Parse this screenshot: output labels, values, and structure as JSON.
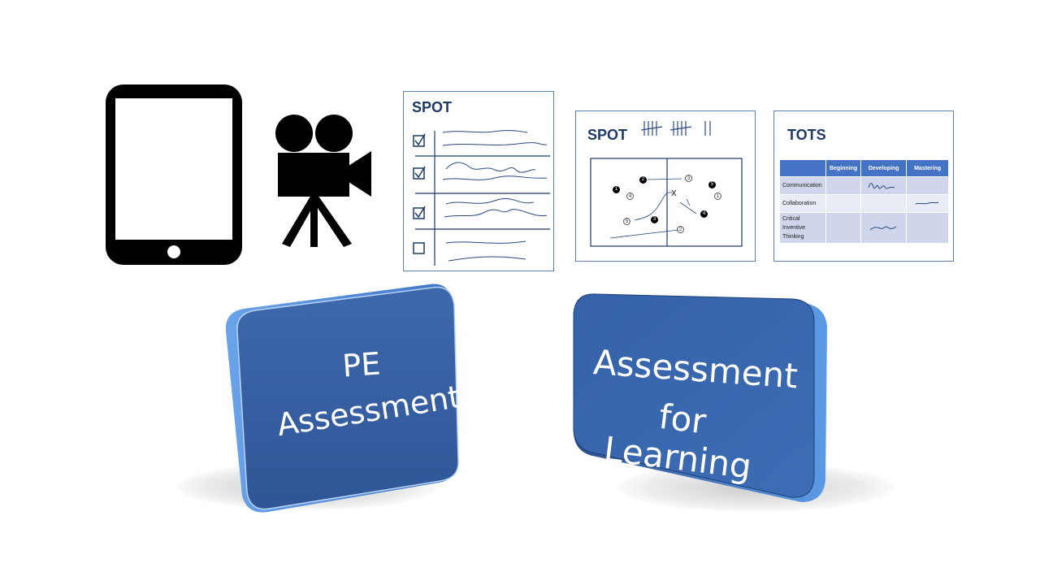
{
  "spot_checklist": {
    "title": "SPOT"
  },
  "spot_field": {
    "title": "SPOT",
    "filled_markers": [
      "1",
      "2",
      "3",
      "4",
      "5"
    ],
    "open_markers": [
      "1",
      "2",
      "3",
      "4",
      "5"
    ],
    "x_marker": "X"
  },
  "tots": {
    "title": "TOTS",
    "columns": [
      "",
      "Beginning",
      "Developing",
      "Mastering"
    ],
    "rows": [
      "Communication",
      "Collaboration",
      "Critical Inventive Thinking"
    ]
  },
  "tiles": {
    "left_line1": "PE",
    "left_line2": "Assessment",
    "right_line1": "Assessment",
    "right_line2": "for Learning"
  },
  "colors": {
    "tile_blue": "#3a64a8",
    "tile_edge": "#5a8fd6",
    "doc_ink": "#1f3864",
    "table_header": "#4472c4"
  },
  "icons": [
    "tablet-icon",
    "video-camera-icon"
  ]
}
